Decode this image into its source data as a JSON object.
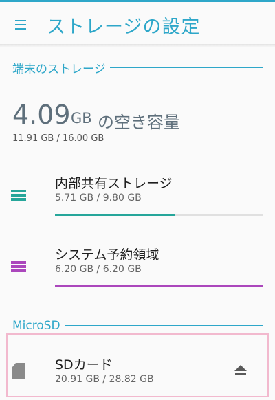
{
  "header": {
    "title": "ストレージの設定",
    "accent_color": "#2ea7c9"
  },
  "device": {
    "section_title": "端末のストレージ",
    "free_value": "4.09",
    "free_unit": "GB",
    "free_label": "の空き容量",
    "total_used": "11.91 GB / 16.00 GB",
    "items": [
      {
        "title": "内部共有ストレージ",
        "usage": "5.71 GB / 9.80 GB",
        "usage_fraction": 0.58,
        "color": "#26a69a",
        "icon": "storage-list-icon"
      },
      {
        "title": "システム予約領域",
        "usage": "6.20 GB / 6.20 GB",
        "usage_fraction": 1.0,
        "color": "#ab47bc",
        "icon": "storage-list-icon"
      }
    ]
  },
  "microsd": {
    "section_title": "MicroSD",
    "card": {
      "title": "SDカード",
      "usage": "20.91 GB / 28.82 GB",
      "icon": "sd-card-icon",
      "action_icon": "eject-icon"
    }
  }
}
